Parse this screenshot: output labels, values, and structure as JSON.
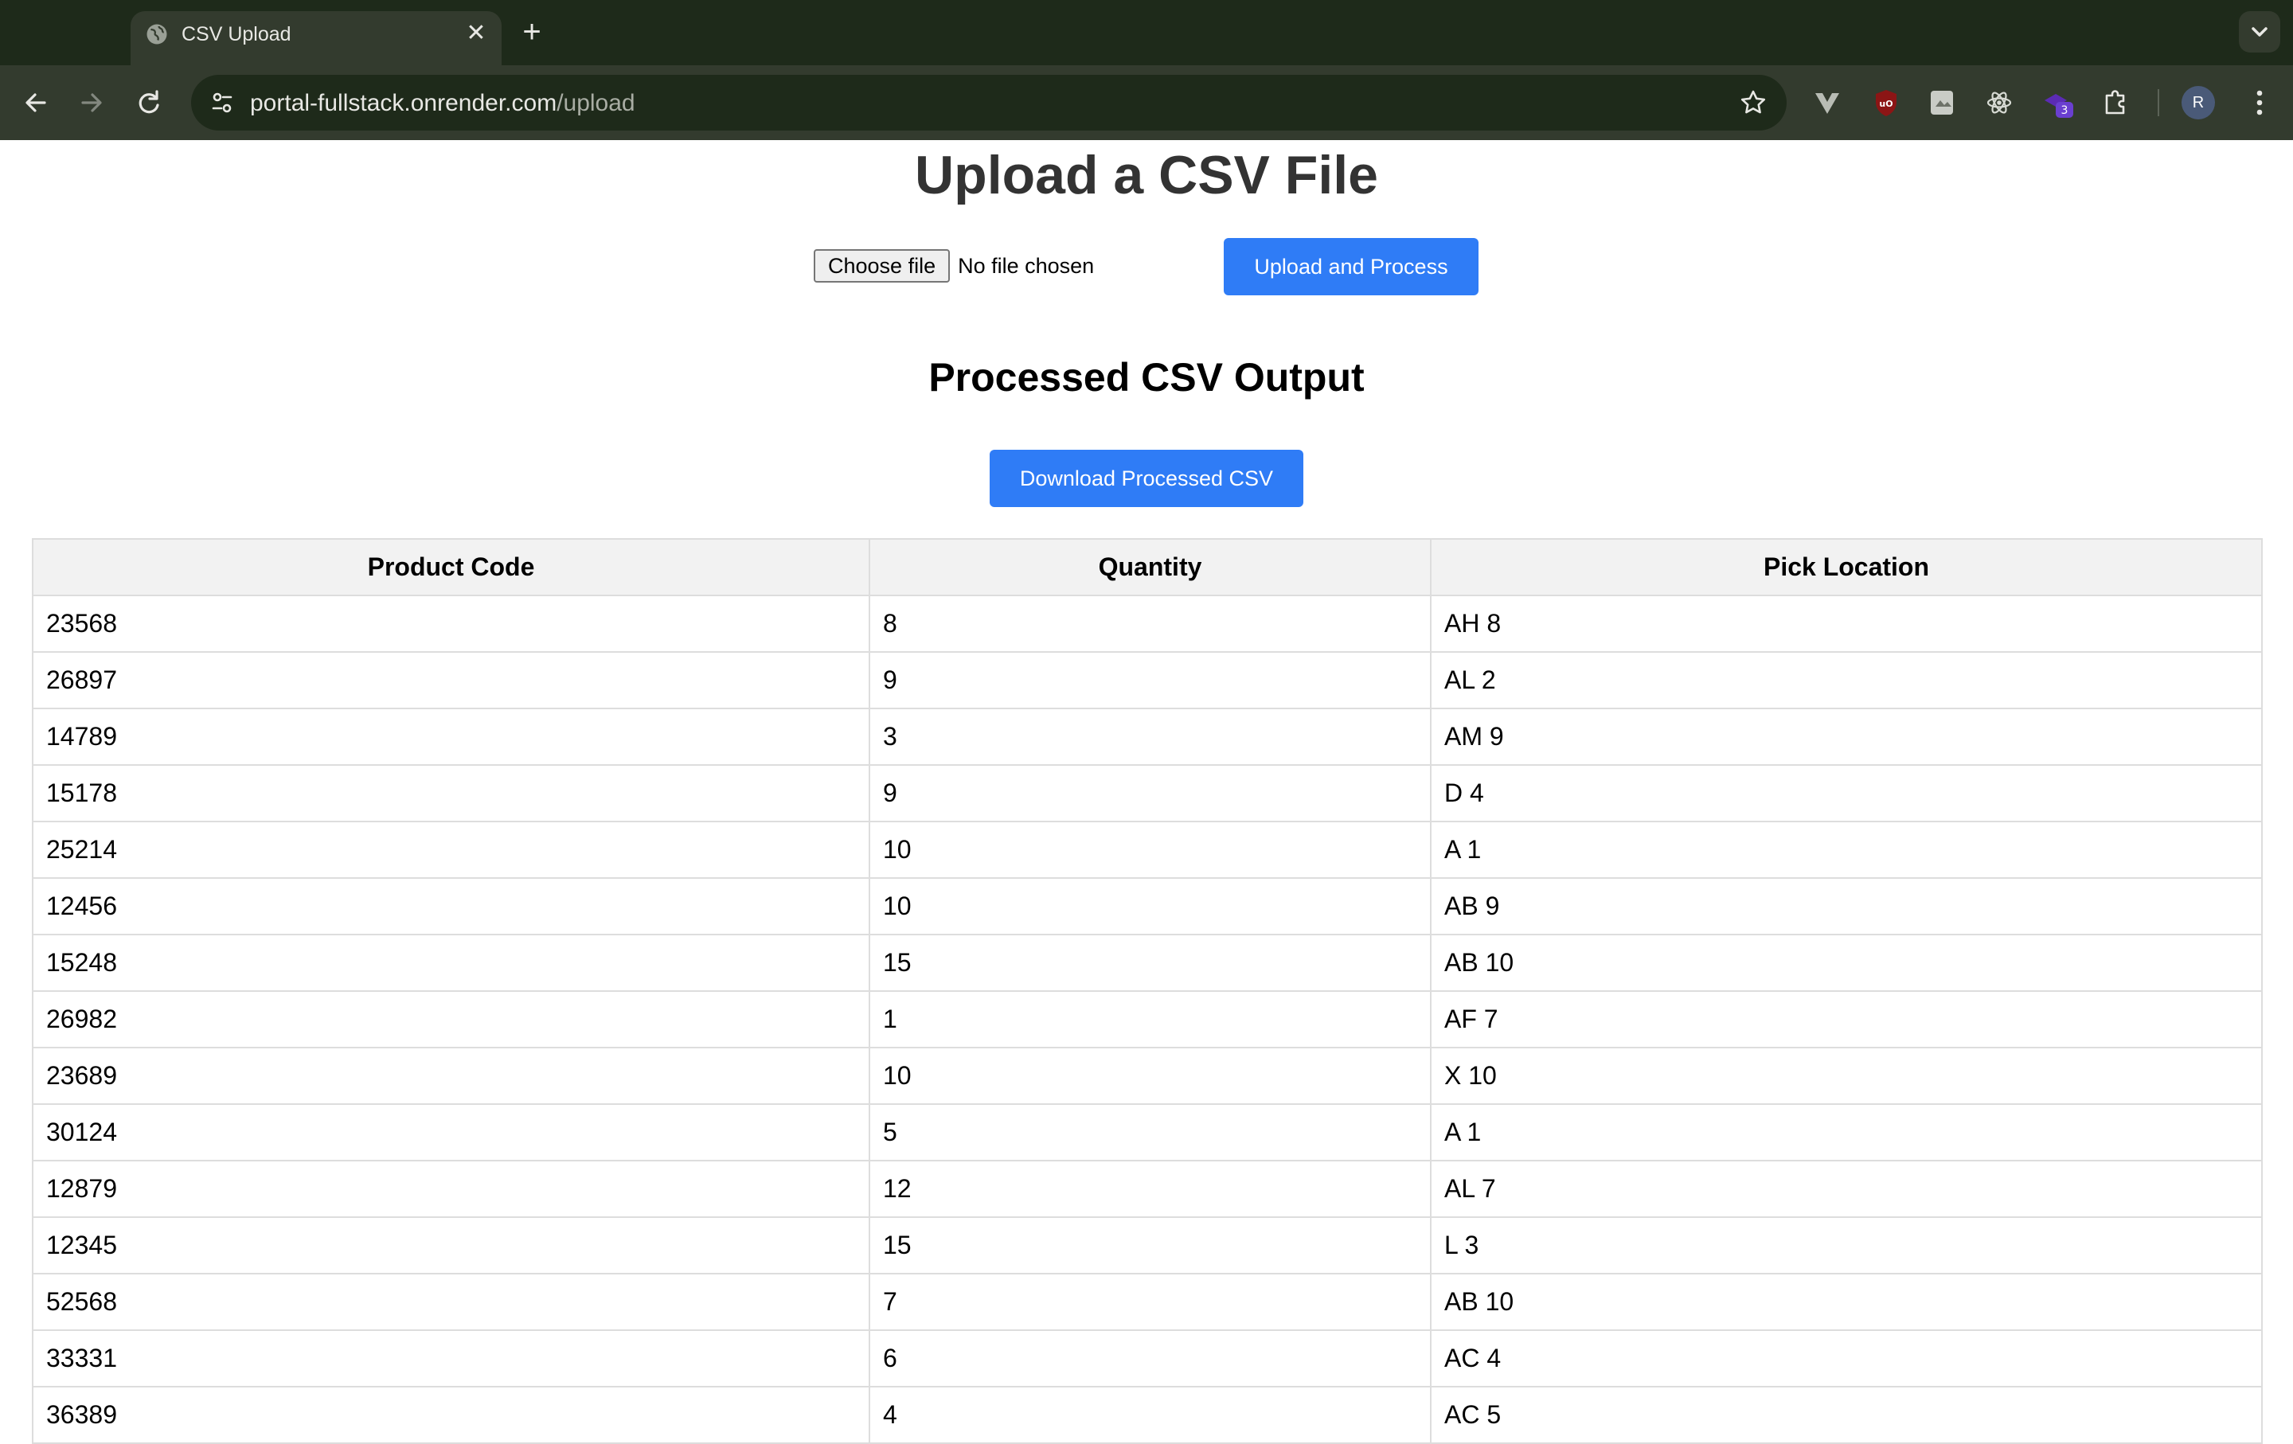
{
  "browser": {
    "tab_title": "CSV Upload",
    "new_tab_symbol": "+",
    "close_symbol": "✕",
    "url_host": "portal-fullstack.onrender.com",
    "url_path": "/upload",
    "profile_initial": "R",
    "extension_badge": "3",
    "extension_icons": [
      "vue-devtools-icon",
      "ublock-origin-icon",
      "extension-page-icon",
      "react-devtools-icon",
      "extension-badge-icon",
      "extensions-puzzle-icon"
    ]
  },
  "page": {
    "title": "Upload a CSV File",
    "choose_file_label": "Choose file",
    "no_file_text": "No file chosen",
    "upload_button": "Upload and Process",
    "output_heading": "Processed CSV Output",
    "download_button": "Download Processed CSV"
  },
  "table": {
    "headers": [
      "Product Code",
      "Quantity",
      "Pick Location"
    ],
    "rows": [
      [
        "23568",
        "8",
        "AH 8"
      ],
      [
        "26897",
        "9",
        "AL 2"
      ],
      [
        "14789",
        "3",
        "AM 9"
      ],
      [
        "15178",
        "9",
        "D 4"
      ],
      [
        "25214",
        "10",
        "A 1"
      ],
      [
        "12456",
        "10",
        "AB 9"
      ],
      [
        "15248",
        "15",
        "AB 10"
      ],
      [
        "26982",
        "1",
        "AF 7"
      ],
      [
        "23689",
        "10",
        "X 10"
      ],
      [
        "30124",
        "5",
        "A 1"
      ],
      [
        "12879",
        "12",
        "AL 7"
      ],
      [
        "12345",
        "15",
        "L 3"
      ],
      [
        "52568",
        "7",
        "AB 10"
      ],
      [
        "33331",
        "6",
        "AC 4"
      ],
      [
        "36389",
        "4",
        "AC 5"
      ]
    ]
  },
  "colors": {
    "tab_strip": "#1e2a1a",
    "toolbar": "#333b2e",
    "primary_button": "#2f7cf6",
    "table_border": "#dddddd",
    "table_header_bg": "#f2f2f2"
  }
}
